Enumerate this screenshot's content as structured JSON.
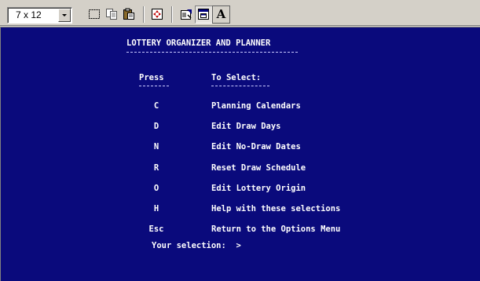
{
  "toolbar": {
    "font_size_value": "7 x 12",
    "icons": [
      "mark-icon",
      "copy-icon",
      "paste-icon",
      "fullscreen-icon",
      "properties-icon",
      "background-icon",
      "font-icon"
    ],
    "font_button_label": "A"
  },
  "console": {
    "title": "LOTTERY ORGANIZER AND PLANNER",
    "col_press": "Press",
    "col_select": "To Select:",
    "menu": [
      {
        "key": "C",
        "label": "Planning Calendars"
      },
      {
        "key": "D",
        "label": "Edit Draw Days"
      },
      {
        "key": "N",
        "label": "Edit No-Draw Dates"
      },
      {
        "key": "R",
        "label": "Reset Draw Schedule"
      },
      {
        "key": "O",
        "label": "Edit Lottery Origin"
      },
      {
        "key": "H",
        "label": "Help with these selections"
      },
      {
        "key": "Esc",
        "label": "Return to the Options Menu"
      }
    ],
    "prompt": "Your selection:  >"
  },
  "colors": {
    "console_bg": "#0a0a7c",
    "console_text": "#ffffff",
    "toolbar_bg": "#d4d0c8"
  }
}
